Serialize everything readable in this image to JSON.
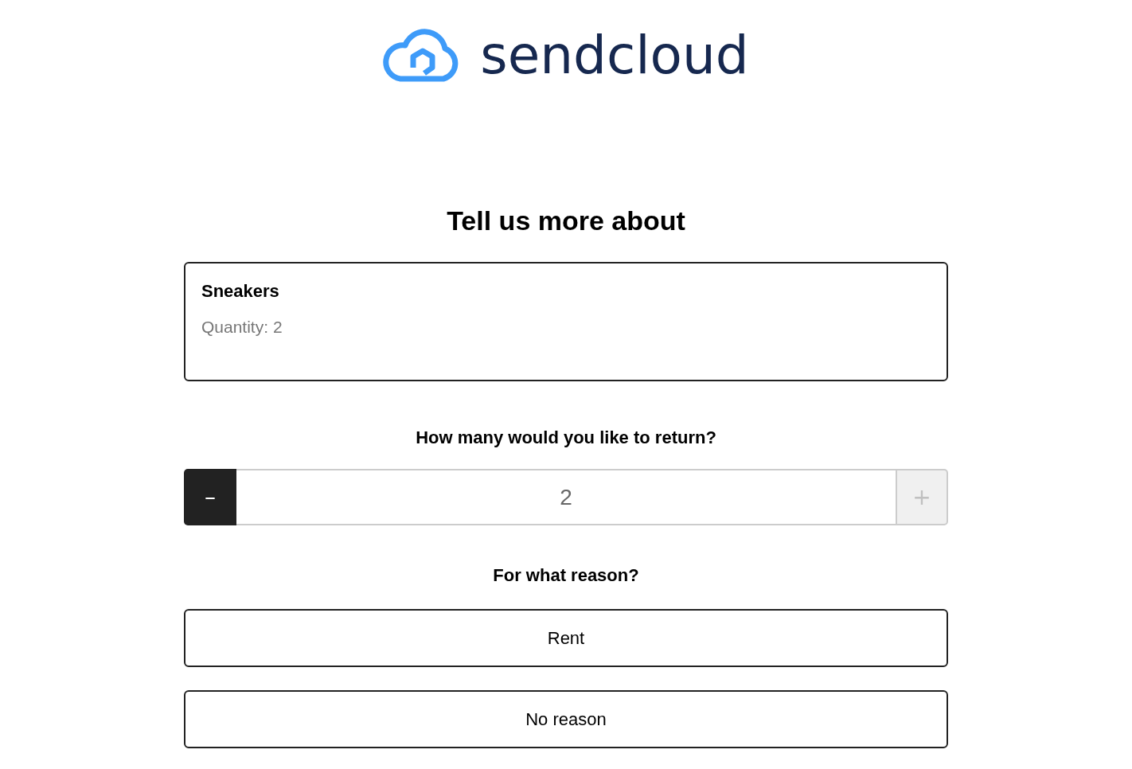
{
  "logo": {
    "text": "sendcloud"
  },
  "heading": "Tell us more about",
  "item": {
    "name": "Sneakers",
    "quantity": "Quantity: 2"
  },
  "quantity_question": "How many would you like to return?",
  "stepper": {
    "value": "2",
    "decrement": {
      "label": "–",
      "disabled": false
    },
    "increment": {
      "label": "+",
      "disabled": true
    }
  },
  "reason_question": "For what reason?",
  "reasons": [
    {
      "label": "Rent",
      "selected": false
    },
    {
      "label": "No reason",
      "selected": false
    }
  ]
}
